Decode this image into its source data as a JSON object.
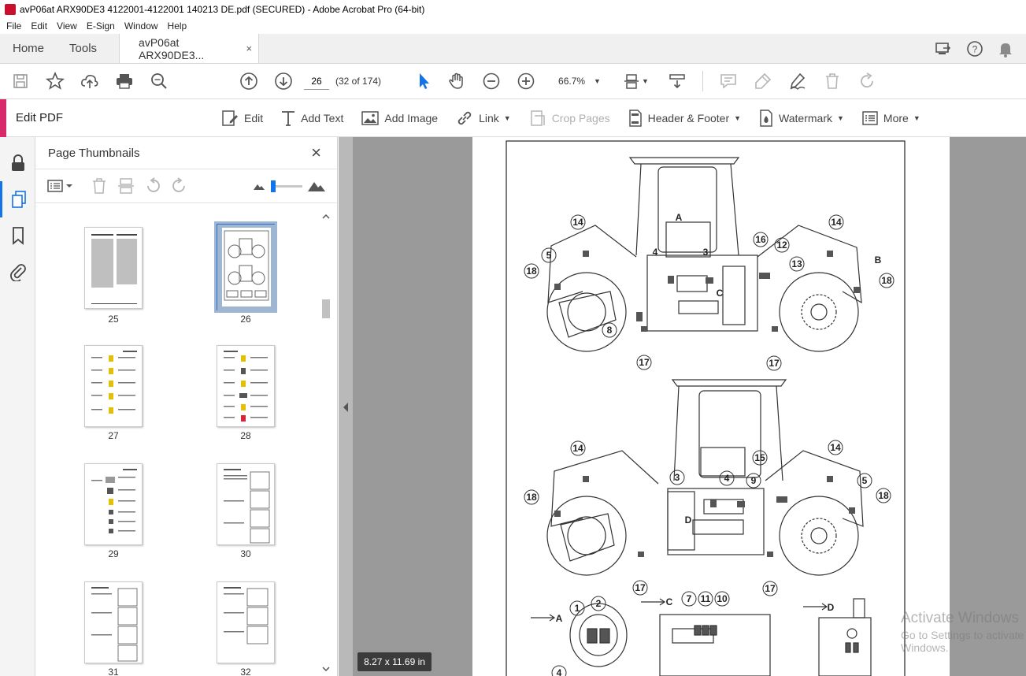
{
  "window": {
    "title": "avP06at ARX90DE3 4122001-4122001 140213 DE.pdf (SECURED) - Adobe Acrobat Pro (64-bit)"
  },
  "menu": [
    "File",
    "Edit",
    "View",
    "E-Sign",
    "Window",
    "Help"
  ],
  "tabs": {
    "home": "Home",
    "tools": "Tools",
    "doc": "avP06at ARX90DE3...",
    "close": "×"
  },
  "toolbar": {
    "page_number": "26",
    "page_count": "(32 of 174)",
    "zoom": "66.7%"
  },
  "editbar": {
    "title": "Edit PDF",
    "tools": [
      {
        "label": "Edit"
      },
      {
        "label": "Add Text"
      },
      {
        "label": "Add Image"
      },
      {
        "label": "Link"
      },
      {
        "label": "Crop Pages"
      },
      {
        "label": "Header & Footer"
      },
      {
        "label": "Watermark"
      },
      {
        "label": "More"
      }
    ]
  },
  "thumbnails": {
    "title": "Page Thumbnails",
    "close": "×",
    "pages": [
      {
        "label": "25"
      },
      {
        "label": "26"
      },
      {
        "label": "27"
      },
      {
        "label": "28"
      },
      {
        "label": "29"
      },
      {
        "label": "30"
      },
      {
        "label": "31"
      },
      {
        "label": "32"
      }
    ]
  },
  "document": {
    "page_size": "8.27 x 11.69 in",
    "callouts": {
      "top": [
        "A",
        "4",
        "3",
        "C",
        "14",
        "5",
        "18",
        "8",
        "17",
        "16",
        "12",
        "13",
        "14",
        "B",
        "18",
        "17"
      ],
      "bottom": [
        "14",
        "18",
        "3",
        "4",
        "D",
        "9",
        "15",
        "14",
        "5",
        "18",
        "17",
        "17"
      ],
      "detail": [
        "A",
        "1",
        "2",
        "4",
        "C",
        "7",
        "11",
        "10",
        "D"
      ]
    }
  },
  "watermark": {
    "line1": "Activate Windows",
    "line2": "Go to Settings to activate Windows."
  }
}
